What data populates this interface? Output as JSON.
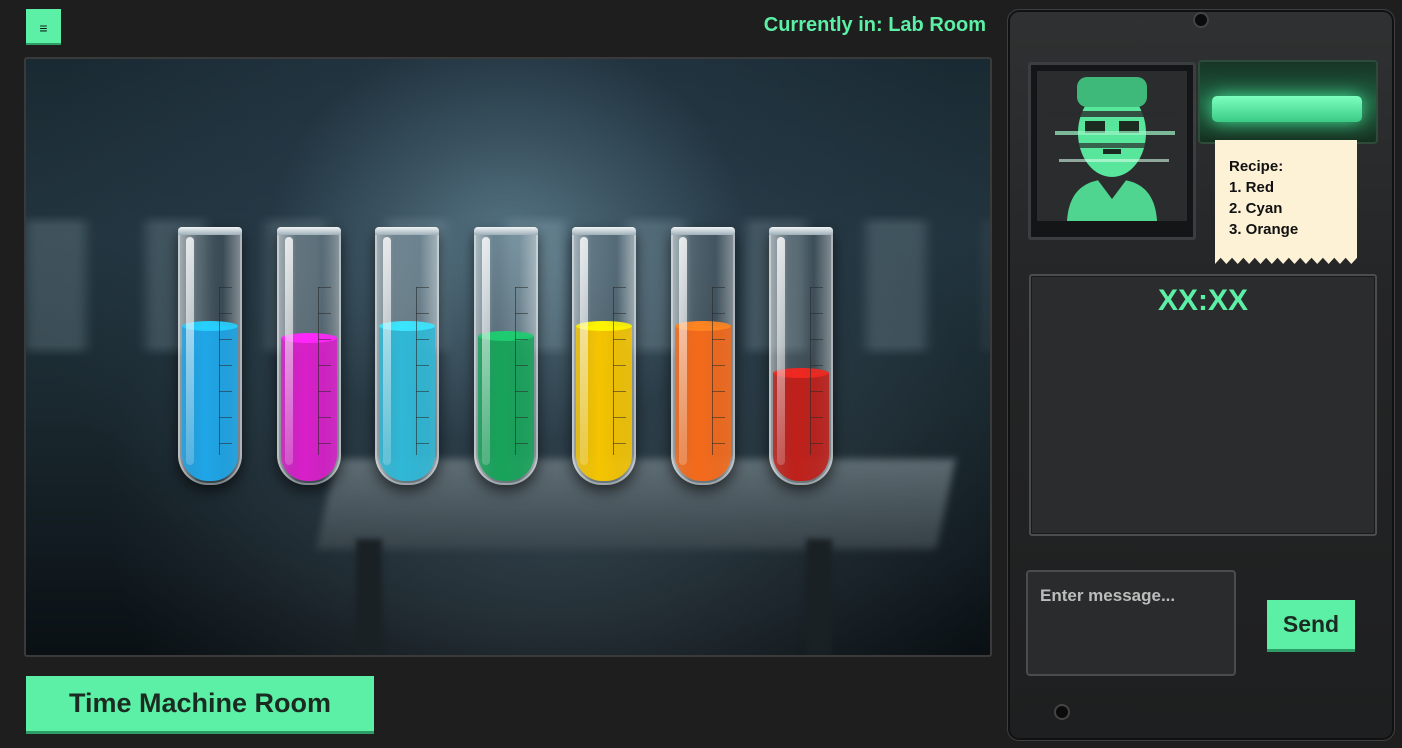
{
  "header": {
    "menu_icon": "≡",
    "location": "Currently in: Lab Room"
  },
  "scene": {
    "tubes": [
      {
        "color": "blue",
        "hex": "#1fa6e8",
        "fill": 0.62
      },
      {
        "color": "magenta",
        "hex": "#d81fc9",
        "fill": 0.57
      },
      {
        "color": "cyan",
        "hex": "#2fb8d6",
        "fill": 0.62
      },
      {
        "color": "green",
        "hex": "#18a35a",
        "fill": 0.58
      },
      {
        "color": "yellow",
        "hex": "#f5c400",
        "fill": 0.62
      },
      {
        "color": "orange",
        "hex": "#f56a1a",
        "fill": 0.62
      },
      {
        "color": "red",
        "hex": "#c0201a",
        "fill": 0.43
      }
    ]
  },
  "navigation": {
    "room_button": "Time Machine Room"
  },
  "device": {
    "recipe": {
      "title": "Recipe:",
      "items": [
        "1. Red",
        "2. Cyan",
        "3. Orange"
      ]
    },
    "timer": "XX:XX",
    "message_placeholder": "Enter message...",
    "send_label": "Send"
  },
  "colors": {
    "accent": "#5cf0a6",
    "background": "#1e1e1e",
    "ticket": "#fdf2d6"
  }
}
